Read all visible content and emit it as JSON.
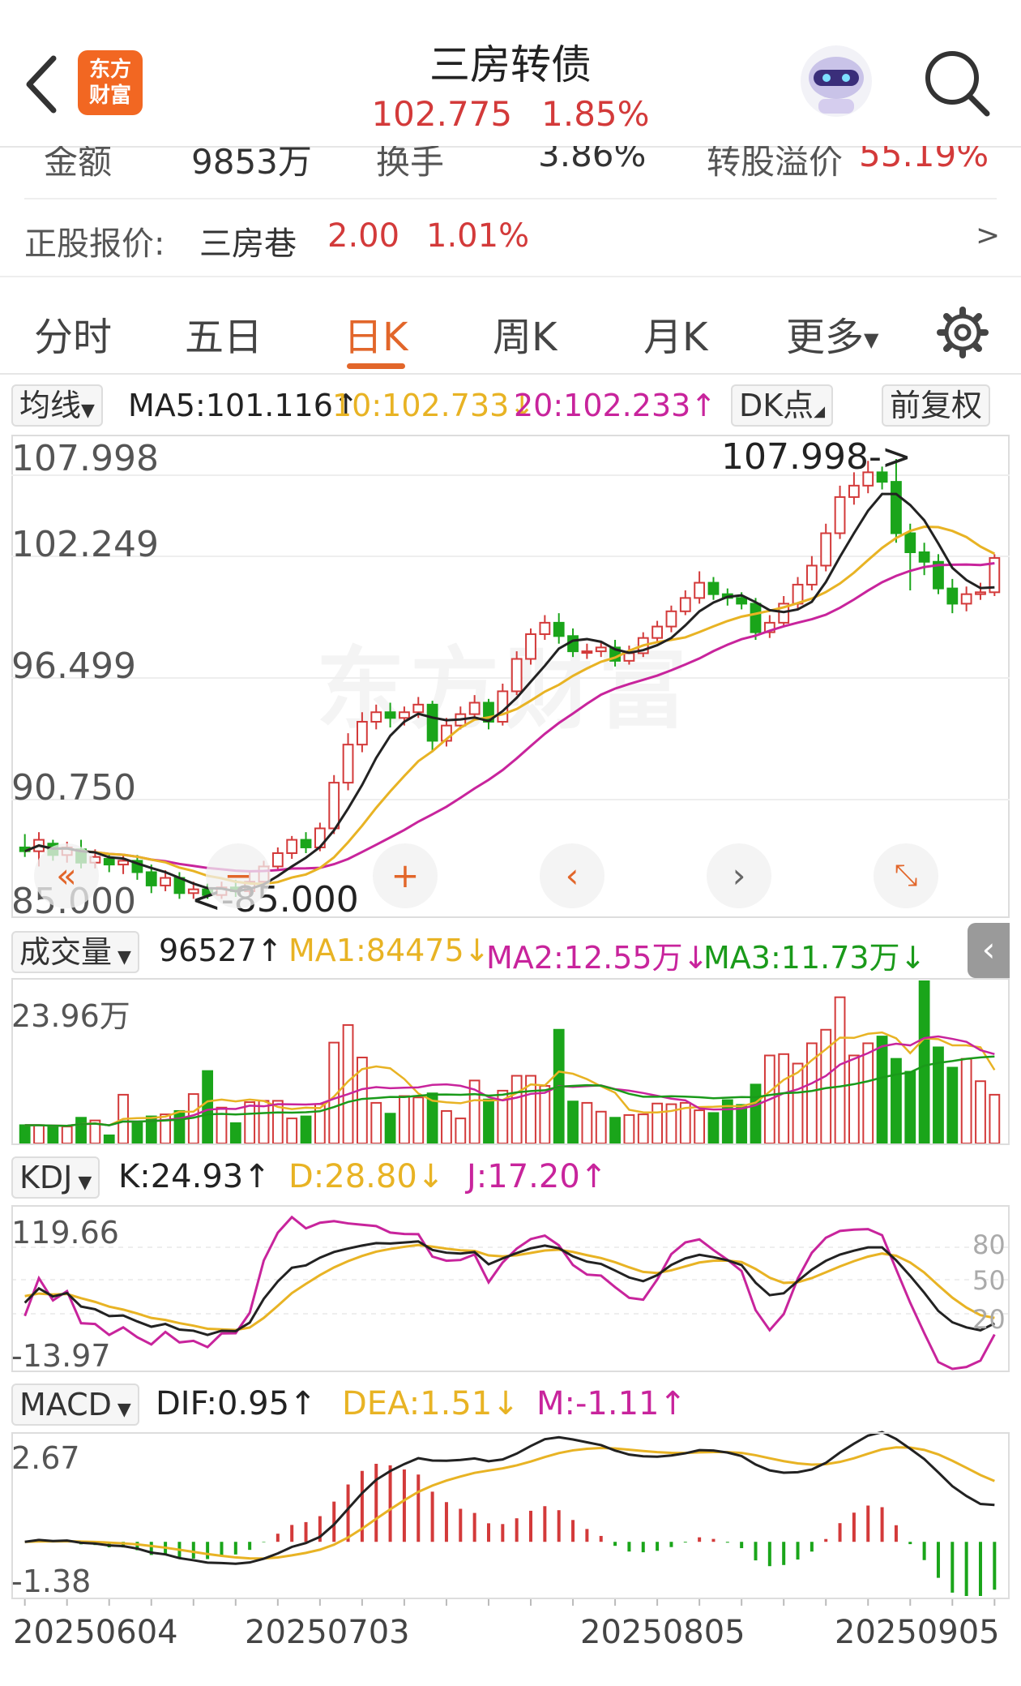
{
  "header": {
    "title": "三房转债",
    "price": "102.775",
    "change_pct": "1.85%",
    "logo_text_1": "东方",
    "logo_text_2": "财富"
  },
  "stats": {
    "amount_label": "金额",
    "amount_value": "9853万",
    "turnover_label": "换手",
    "turnover_value": "3.86%",
    "premium_label": "转股溢价",
    "premium_value": "55.19%"
  },
  "stock": {
    "label": "正股报价:",
    "name": "三房巷",
    "price": "2.00",
    "change": "1.01%",
    "arrow": ">"
  },
  "tabs": [
    "分时",
    "五日",
    "日K",
    "周K",
    "月K",
    "更多"
  ],
  "active_tab": 2,
  "ma_bar": {
    "selector": "均线",
    "ma5": "MA5:101.116",
    "ma5_arrow": "↑",
    "ma10": "10:102.733",
    "ma10_arrow": "↓",
    "ma20": "20:102.233",
    "ma20_arrow": "↑",
    "dk_button": "DK点",
    "adjust_button": "前复权"
  },
  "kline_axis": [
    "107.998",
    "102.249",
    "96.499",
    "90.750",
    "85.000"
  ],
  "kline_marks": {
    "high": "107.998->",
    "low": "<-85.000"
  },
  "vol_bar": {
    "selector": "成交量",
    "value": "96527",
    "value_arrow": "↑",
    "ma1": "MA1:84475",
    "ma1_arrow": "↓",
    "ma2": "MA2:12.55万",
    "ma2_arrow": "↓",
    "ma3": "MA3:11.73万",
    "ma3_arrow": "↓",
    "max_label": "23.96万"
  },
  "kdj_bar": {
    "selector": "KDJ",
    "k": "K:24.93",
    "k_arrow": "↑",
    "d": "D:28.80",
    "d_arrow": "↓",
    "j": "J:17.20",
    "j_arrow": "↑",
    "max_label": "119.66",
    "min_label": "-13.97",
    "levels": [
      "80",
      "50",
      "20"
    ]
  },
  "macd_bar": {
    "selector": "MACD",
    "dif": "DIF:0.95",
    "dif_arrow": "↑",
    "dea": "DEA:1.51",
    "dea_arrow": "↓",
    "m": "M:-1.11",
    "m_arrow": "↑",
    "max_label": "2.67",
    "min_label": "-1.38"
  },
  "dates": [
    "20250604",
    "20250703",
    "20250805",
    "20250905"
  ],
  "watermark": "东方财富",
  "colors": {
    "up": "#d33a3a",
    "down": "#1aa51a",
    "ma5": "#222222",
    "ma10": "#e8b324",
    "ma20": "#c8249c",
    "accent": "#e2662a"
  },
  "icons": [
    "back-icon",
    "robot-icon",
    "search-icon",
    "gear-icon",
    "collapse-left-icon",
    "rewind-icon",
    "minus-icon",
    "plus-icon",
    "prev-icon",
    "next-icon",
    "expand-icon"
  ],
  "chart_data": {
    "type": "candlestick",
    "period": "daily",
    "ylim": [
      85.0,
      107.998
    ],
    "candles": [
      [
        87.6,
        87.4,
        88.3,
        87.1
      ],
      [
        87.4,
        88.0,
        88.4,
        86.6
      ],
      [
        87.8,
        87.2,
        88.0,
        86.9
      ],
      [
        87.2,
        87.6,
        87.9,
        86.8
      ],
      [
        87.5,
        86.8,
        88.0,
        86.5
      ],
      [
        86.8,
        87.1,
        87.5,
        86.5
      ],
      [
        87.0,
        86.7,
        87.3,
        86.3
      ],
      [
        86.7,
        86.9,
        87.2,
        86.2
      ],
      [
        86.9,
        86.3,
        87.2,
        85.9
      ],
      [
        86.3,
        85.6,
        86.7,
        85.2
      ],
      [
        85.6,
        86.0,
        86.4,
        85.3
      ],
      [
        86.0,
        85.2,
        86.3,
        84.9
      ],
      [
        85.2,
        85.4,
        85.8,
        84.9
      ],
      [
        85.4,
        85.1,
        85.7,
        84.9
      ],
      [
        85.1,
        85.5,
        85.8,
        84.9
      ],
      [
        85.5,
        85.3,
        85.9,
        85.0
      ],
      [
        85.3,
        85.8,
        86.3,
        85.1
      ],
      [
        85.8,
        86.6,
        86.9,
        85.6
      ],
      [
        86.6,
        87.3,
        87.6,
        86.4
      ],
      [
        87.3,
        88.0,
        88.2,
        87.0
      ],
      [
        88.0,
        87.6,
        88.4,
        87.3
      ],
      [
        87.6,
        88.6,
        88.9,
        87.4
      ],
      [
        88.6,
        91.0,
        91.4,
        88.3
      ],
      [
        91.0,
        93.0,
        93.6,
        90.6
      ],
      [
        93.0,
        94.2,
        94.7,
        92.6
      ],
      [
        94.2,
        94.7,
        95.1,
        93.8
      ],
      [
        94.7,
        94.4,
        95.2,
        93.9
      ],
      [
        94.4,
        94.7,
        95.0,
        94.0
      ],
      [
        94.7,
        95.1,
        95.5,
        94.4
      ],
      [
        95.1,
        93.2,
        95.3,
        92.6
      ],
      [
        93.2,
        94.0,
        94.4,
        92.9
      ],
      [
        94.0,
        94.6,
        95.0,
        93.8
      ],
      [
        94.6,
        95.2,
        95.6,
        94.3
      ],
      [
        95.2,
        94.2,
        95.4,
        93.8
      ],
      [
        94.2,
        95.8,
        96.2,
        94.0
      ],
      [
        95.8,
        97.5,
        97.9,
        95.6
      ],
      [
        97.5,
        98.8,
        99.1,
        97.2
      ],
      [
        98.8,
        99.4,
        99.8,
        98.5
      ],
      [
        99.4,
        98.7,
        99.9,
        98.3
      ],
      [
        98.7,
        97.9,
        99.1,
        97.6
      ],
      [
        97.9,
        97.9,
        98.3,
        97.5
      ],
      [
        97.9,
        98.1,
        98.4,
        97.6
      ],
      [
        98.1,
        97.4,
        98.5,
        97.1
      ],
      [
        97.4,
        97.8,
        98.2,
        97.2
      ],
      [
        97.8,
        98.6,
        98.9,
        97.6
      ],
      [
        98.6,
        99.2,
        99.5,
        98.4
      ],
      [
        99.2,
        100.0,
        100.3,
        98.9
      ],
      [
        100.0,
        100.7,
        101.1,
        99.8
      ],
      [
        100.7,
        101.5,
        102.1,
        100.4
      ],
      [
        101.5,
        100.9,
        101.8,
        100.6
      ],
      [
        100.9,
        100.7,
        101.2,
        100.3
      ],
      [
        100.7,
        100.4,
        101.0,
        100.1
      ],
      [
        100.4,
        98.9,
        100.7,
        98.5
      ],
      [
        98.9,
        99.4,
        99.8,
        98.6
      ],
      [
        99.4,
        100.4,
        100.8,
        99.2
      ],
      [
        100.4,
        101.4,
        101.8,
        100.1
      ],
      [
        101.4,
        102.4,
        102.9,
        101.1
      ],
      [
        102.4,
        104.1,
        104.6,
        102.1
      ],
      [
        104.1,
        106.0,
        106.6,
        103.8
      ],
      [
        106.0,
        106.6,
        107.3,
        105.6
      ],
      [
        106.6,
        107.3,
        107.9,
        106.2
      ],
      [
        107.3,
        106.8,
        107.6,
        106.4
      ],
      [
        106.8,
        104.1,
        108.0,
        103.6
      ],
      [
        104.1,
        103.1,
        104.6,
        101.1
      ],
      [
        103.1,
        102.6,
        103.6,
        101.9
      ],
      [
        102.6,
        101.2,
        103.0,
        100.9
      ],
      [
        101.2,
        100.4,
        101.7,
        99.9
      ],
      [
        100.4,
        100.9,
        101.3,
        100.0
      ],
      [
        100.9,
        101.0,
        101.5,
        100.6
      ],
      [
        101.0,
        102.8,
        103.0,
        100.8
      ]
    ],
    "volume_ylim": [
      0,
      239600
    ],
    "volume": [
      27000,
      27000,
      25000,
      25000,
      38000,
      34000,
      12000,
      72000,
      31000,
      40000,
      43000,
      48000,
      73000,
      107000,
      53000,
      30000,
      61000,
      63000,
      63000,
      37000,
      40000,
      58000,
      149000,
      175000,
      127000,
      60000,
      44000,
      70000,
      68000,
      74000,
      48000,
      37000,
      93000,
      65000,
      78000,
      100000,
      100000,
      85000,
      168000,
      62000,
      60000,
      47000,
      38000,
      42000,
      43000,
      59000,
      58000,
      60000,
      49000,
      45000,
      64000,
      57000,
      87000,
      130000,
      132000,
      118000,
      148000,
      168000,
      216000,
      130000,
      148000,
      158000,
      125000,
      106000,
      239600,
      142000,
      112000,
      125000,
      92000,
      72000
    ]
  }
}
